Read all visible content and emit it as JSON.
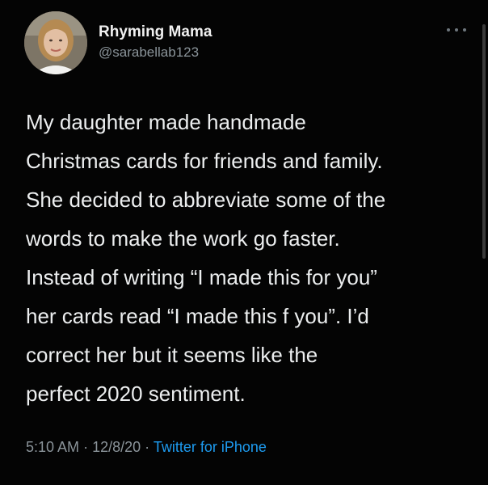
{
  "author": {
    "display_name": "Rhyming Mama",
    "handle": "@sarabellab123"
  },
  "tweet": {
    "lines": [
      "My daughter made handmade",
      "Christmas cards for friends and family.",
      "She decided to abbreviate some of the",
      "words to make the work go faster.",
      "Instead of writing “I made this for you”",
      "her cards read “I made this f you”. I’d",
      "correct her but it seems like the",
      "perfect 2020 sentiment."
    ]
  },
  "meta": {
    "time": "5:10 AM",
    "separator": "·",
    "date": "12/8/20",
    "source": "Twitter for iPhone"
  },
  "icons": {
    "more": "more-options-icon"
  },
  "colors": {
    "background": "#040404",
    "text": "#eceeef",
    "muted": "#8b949a",
    "link": "#1d9bf0"
  }
}
